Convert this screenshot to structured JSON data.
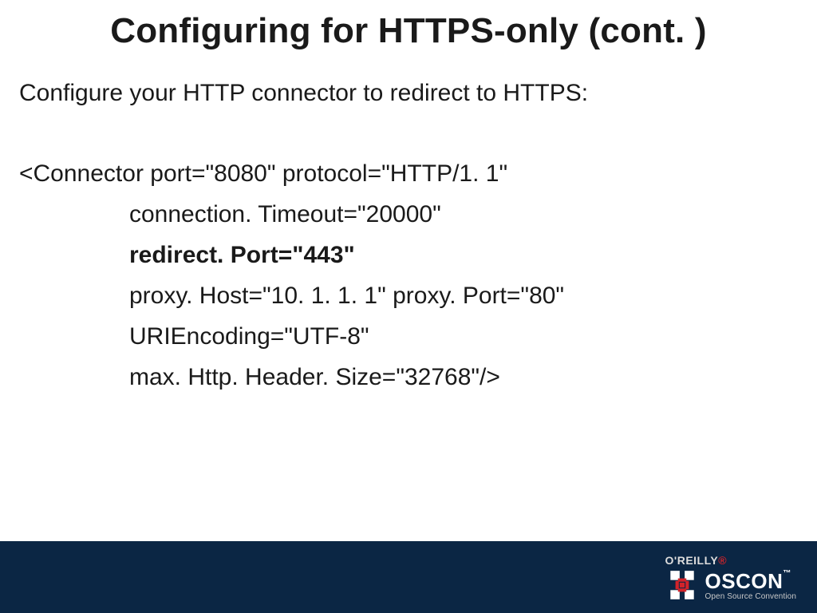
{
  "title": "Configuring for HTTPS-only (cont. )",
  "subtitle": "Configure your HTTP connector to redirect to HTTPS:",
  "code": {
    "line1": "<Connector port=\"8080\" protocol=\"HTTP/1. 1\"",
    "line2": "connection. Timeout=\"20000\"",
    "line3": "redirect. Port=\"443\"",
    "line4": "proxy. Host=\"10. 1. 1. 1\" proxy. Port=\"80\"",
    "line5": "URIEncoding=\"UTF-8\"",
    "line6": "max. Http. Header. Size=\"32768\"/>"
  },
  "footer": {
    "publisher": "O'REILLY",
    "publisher_mark": "®",
    "conference": "OSCON",
    "tm": "™",
    "tagline": "Open Source Convention"
  }
}
